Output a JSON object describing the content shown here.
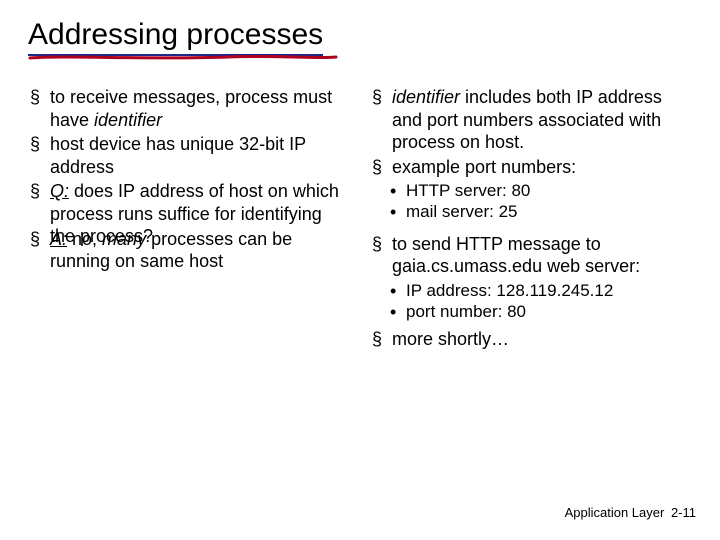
{
  "title": "Addressing processes",
  "left": {
    "b1a": "to receive messages, process  must have ",
    "b1b": "identifier",
    "b2": "host device has unique 32-bit IP address",
    "b3a": "Q:",
    "b3b": " does  IP address of host on which process runs suffice for identifying the process?",
    "b4a": "A:",
    "b4b": " no, ",
    "b4c": "many",
    "b4d": " processes can be running on same host"
  },
  "right": {
    "b1a": "identifier",
    "b1b": " includes both IP address and port numbers associated with process on host.",
    "b2": "example port numbers:",
    "b2s1": "HTTP server: 80",
    "b2s2": "mail server: 25",
    "b3": "to send HTTP message to gaia.cs.umass.edu web server:",
    "b3s1": "IP address: 128.119.245.12",
    "b3s2": "port number: 80",
    "b4": "more shortly…"
  },
  "footer": {
    "section": "Application Layer",
    "page": "2-11"
  }
}
